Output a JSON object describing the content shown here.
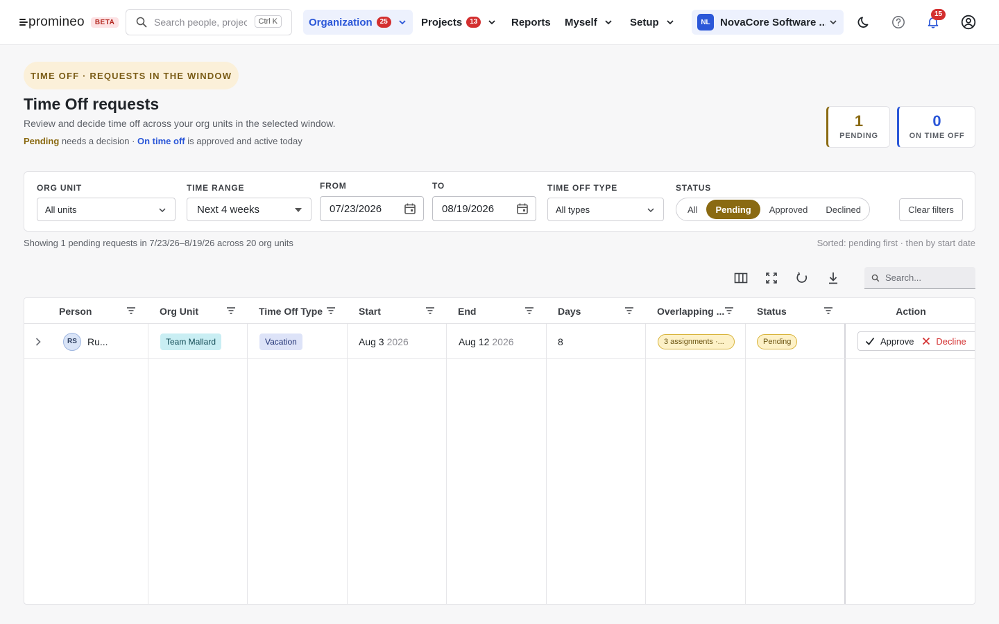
{
  "nav": {
    "logo": "promineo",
    "beta": "BETA",
    "search_placeholder": "Search people, projects",
    "search_shortcut": "Ctrl K",
    "items": [
      {
        "label": "Organization",
        "badge": "25"
      },
      {
        "label": "Projects",
        "badge": "13"
      },
      {
        "label": "Reports"
      },
      {
        "label": "Myself"
      },
      {
        "label": "Setup"
      }
    ],
    "org": {
      "initials": "NL",
      "name": "NovaCore Software ..."
    },
    "notifications": "15"
  },
  "header": {
    "eyebrow": "TIME OFF · REQUESTS IN THE WINDOW",
    "title": "Time Off requests",
    "subtitle": "Review and decide time off across your org units in the selected window.",
    "legend_pending": "Pending",
    "legend_pending_desc": " needs a decision · ",
    "legend_ontime": "On time off",
    "legend_ontime_desc": " is approved and active today"
  },
  "stats": {
    "pending": {
      "value": "1",
      "label": "PENDING"
    },
    "on_time_off": {
      "value": "0",
      "label": "ON TIME OFF"
    }
  },
  "filters": {
    "org_unit": {
      "label": "ORG UNIT",
      "value": "All units"
    },
    "time_range": {
      "label": "TIME RANGE",
      "value": "Next 4 weeks"
    },
    "from": {
      "label": "FROM",
      "value": "07/23/2026"
    },
    "to": {
      "label": "TO",
      "value": "08/19/2026"
    },
    "type": {
      "label": "TIME OFF TYPE",
      "value": "All types"
    },
    "status": {
      "label": "STATUS",
      "options": [
        "All",
        "Pending",
        "Approved",
        "Declined"
      ],
      "selected": "Pending"
    },
    "clear": "Clear filters"
  },
  "summary": {
    "showing": "Showing 1 pending requests in 7/23/26–8/19/26 across 20 org units",
    "sorted": "Sorted: pending first · then by start date"
  },
  "grid": {
    "search_placeholder": "Search...",
    "columns": [
      "Person",
      "Org Unit",
      "Time Off Type",
      "Start",
      "End",
      "Days",
      "Overlapping ...",
      "Status",
      "Action"
    ],
    "rows": [
      {
        "initials": "RS",
        "person": "Ru...",
        "org_unit": "Team Mallard",
        "type": "Vacation",
        "start_day": "Aug 3",
        "start_year": "2026",
        "end_day": "Aug 12",
        "end_year": "2026",
        "days": "8",
        "overlap": "3 assignments ·...",
        "status": "Pending",
        "approve": "Approve",
        "decline": "Decline"
      }
    ]
  },
  "colors": {
    "accent": "#2b57d8",
    "pending": "#8a6a12",
    "danger": "#d32f2f"
  }
}
